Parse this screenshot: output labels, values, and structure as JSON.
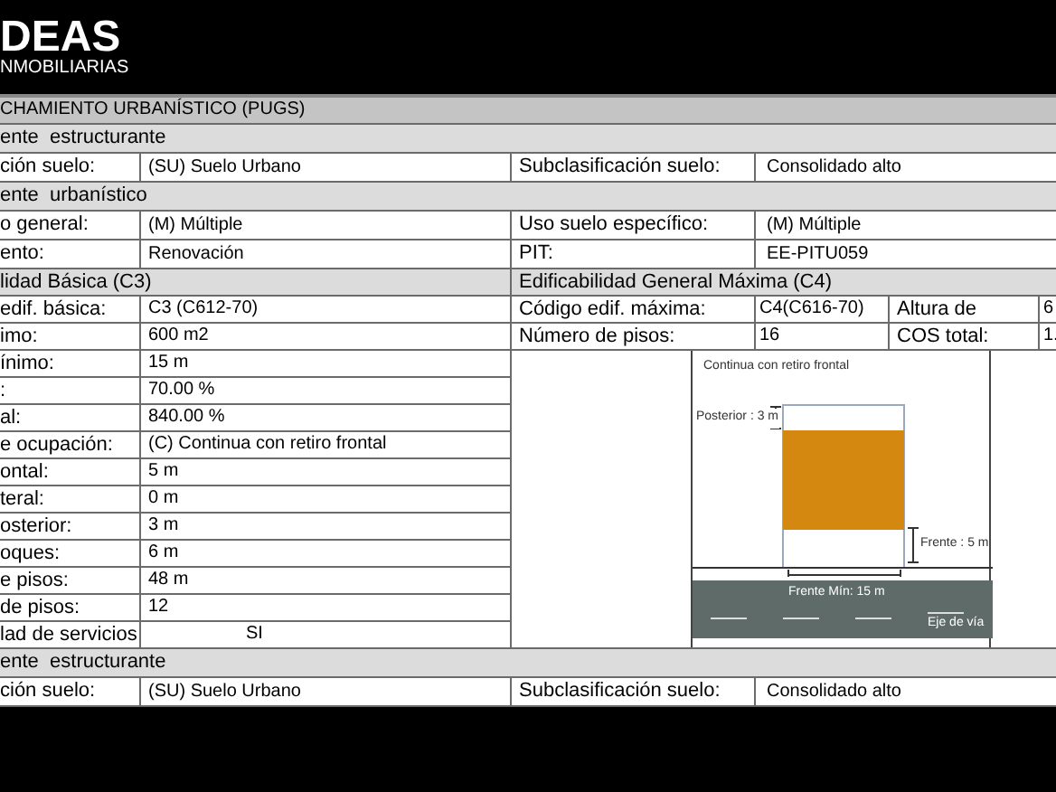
{
  "logo": {
    "name": "DEAS",
    "tagline": "NMOBILIARIAS"
  },
  "title": "CHAMIENTO URBANÍSTICO (PUGS)",
  "top": [
    {
      "kind": "section",
      "label": "ente  estructurante"
    },
    {
      "kind": "row",
      "cells": [
        "ción suelo:",
        "(SU) Suelo Urbano",
        "Subclasificación suelo:",
        "Consolidado alto"
      ]
    },
    {
      "kind": "section",
      "label": "ente  urbanístico"
    },
    {
      "kind": "row",
      "cells": [
        "o general:",
        "(M) Múltiple",
        "Uso suelo específico:",
        "(M) Múltiple"
      ]
    },
    {
      "kind": "row",
      "cells": [
        "ento:",
        "Renovación",
        "PIT:",
        "EE-PITU059"
      ]
    }
  ],
  "split": {
    "left_heading": "lidad Básica (C3)",
    "right_heading": "Edificabilidad General Máxima (C4)",
    "left_rows": [
      {
        "kind": "plain",
        "label": "edif. básica:",
        "value": "C3 (C612-70)"
      },
      {
        "kind": "plain",
        "label": "imo:",
        "value": "600 m2"
      },
      {
        "kind": "plain",
        "label": "ínimo:",
        "value": "15 m"
      },
      {
        "kind": "plain",
        "label": ":",
        "value": "70.00 %"
      },
      {
        "kind": "plain",
        "label": "al:",
        "value": "840.00 %"
      },
      {
        "kind": "plain",
        "label": "e ocupación:",
        "value": "(C) Continua con retiro frontal"
      },
      {
        "kind": "plain",
        "label": "ontal:",
        "value": "5 m"
      },
      {
        "kind": "plain",
        "label": "teral:",
        "value": "0 m"
      },
      {
        "kind": "plain",
        "label": "osterior:",
        "value": "3 m"
      },
      {
        "kind": "plain",
        "label": "oques:",
        "value": "6 m"
      },
      {
        "kind": "plain",
        "label": "e pisos:",
        "value": "48 m"
      },
      {
        "kind": "plain",
        "label": "de pisos:",
        "value": "12"
      },
      {
        "kind": "flag",
        "label": "lad de servicios",
        "value": "SI"
      }
    ],
    "right_rows": [
      [
        "Código edif. máxima:",
        "C4(C616-70)",
        "Altura de",
        "6"
      ],
      [
        "Número de pisos:",
        "16",
        "COS total:",
        "1."
      ]
    ],
    "diagram": {
      "caption": "Continua con retiro frontal",
      "rear": "Posterior : 3 m",
      "front": "Frente : 5 m",
      "min_front": "Frente Mín: 15 m",
      "axis": "Eje de vía"
    }
  },
  "bottom": [
    {
      "kind": "section",
      "label": "ente  estructurante"
    },
    {
      "kind": "row",
      "cells": [
        "ción suelo:",
        "(SU) Suelo Urbano",
        "Subclasificación suelo:",
        "Consolidado alto"
      ]
    }
  ]
}
